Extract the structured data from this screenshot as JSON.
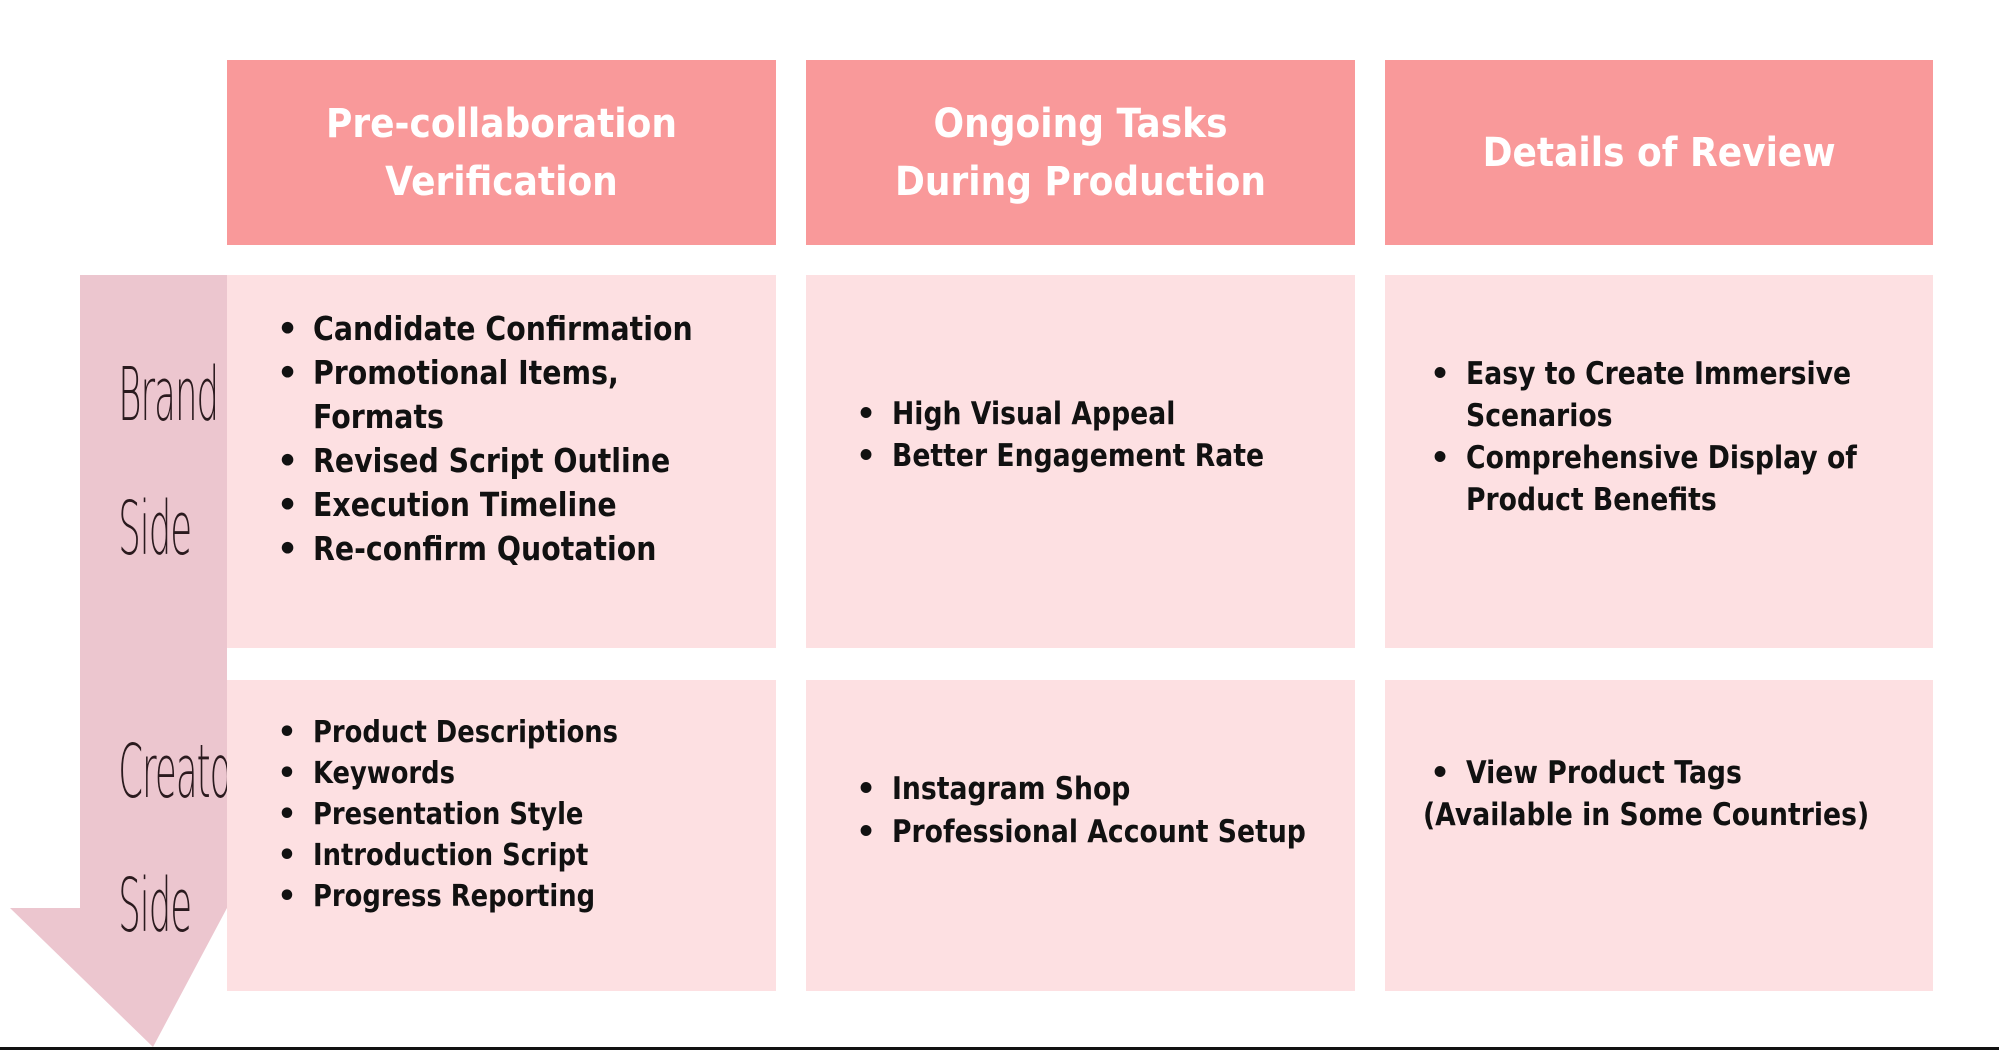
{
  "colors": {
    "header_bg": "#f9999a",
    "header_text": "#ffffff",
    "cell_bg": "#fde0e2",
    "arrow_bg": "#ecc6cf",
    "body_text": "#111111",
    "side_label_text": "#2a1a1e"
  },
  "columns": [
    {
      "title": "Pre-collaboration Verification"
    },
    {
      "title": "Ongoing Tasks During Production"
    },
    {
      "title": "Details of Review"
    }
  ],
  "flow_arrow": {
    "icon": "down-arrow-icon",
    "rows": [
      {
        "label_line1": "Brand",
        "label_line2": "Side"
      },
      {
        "label_line1": "Creator",
        "label_line2": "Side"
      }
    ]
  },
  "rows": {
    "brand": {
      "cells": [
        {
          "items": [
            "Candidate Confirmation",
            "Promotional Items,\nFormats",
            "Revised Script Outline",
            "Execution Timeline",
            "Re-confirm Quotation"
          ]
        },
        {
          "items": [
            "High Visual Appeal",
            "Better Engagement Rate"
          ]
        },
        {
          "items": [
            "Easy to Create Immersive\nScenarios",
            "Comprehensive Display of\nProduct Benefits"
          ]
        }
      ]
    },
    "creator": {
      "cells": [
        {
          "items": [
            "Product Descriptions",
            "Keywords",
            "Presentation Style",
            "Introduction Script",
            "Progress Reporting"
          ]
        },
        {
          "items": [
            "Instagram Shop",
            "Professional Account Setup"
          ]
        },
        {
          "items": [
            "View Product Tags"
          ],
          "note": "(Available in Some Countries)"
        }
      ]
    }
  },
  "bullet_glyph": "•"
}
